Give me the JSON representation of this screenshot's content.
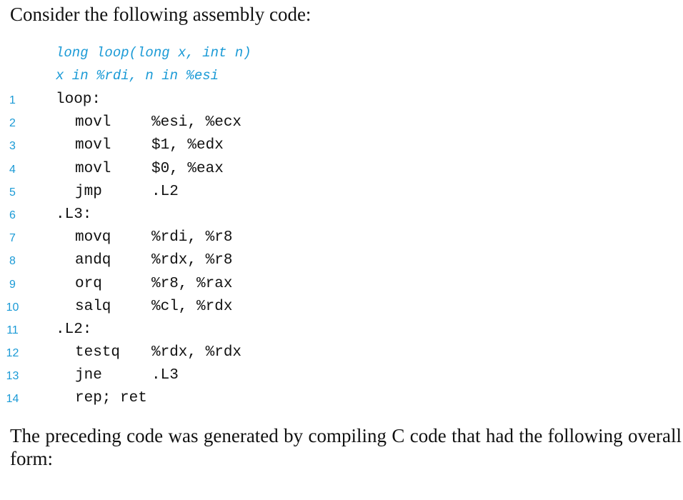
{
  "intro_text": "Consider the following assembly code:",
  "signature": {
    "line1": "long loop(long x, int n)",
    "line2": "x in %rdi, n in %esi"
  },
  "colors": {
    "accent": "#1a9ad6",
    "text": "#111111"
  },
  "code_lines": [
    {
      "num": "1",
      "label": "loop:",
      "op": "",
      "args": ""
    },
    {
      "num": "2",
      "label": "",
      "op": "movl",
      "args": "%esi, %ecx"
    },
    {
      "num": "3",
      "label": "",
      "op": "movl",
      "args": "$1, %edx"
    },
    {
      "num": "4",
      "label": "",
      "op": "movl",
      "args": "$0, %eax"
    },
    {
      "num": "5",
      "label": "",
      "op": "jmp",
      "args": ".L2"
    },
    {
      "num": "6",
      "label": ".L3:",
      "op": "",
      "args": ""
    },
    {
      "num": "7",
      "label": "",
      "op": "movq",
      "args": "%rdi, %r8"
    },
    {
      "num": "8",
      "label": "",
      "op": "andq",
      "args": "%rdx, %r8"
    },
    {
      "num": "9",
      "label": "",
      "op": "orq",
      "args": "%r8, %rax"
    },
    {
      "num": "10",
      "label": "",
      "op": "salq",
      "args": "%cl, %rdx"
    },
    {
      "num": "11",
      "label": ".L2:",
      "op": "",
      "args": ""
    },
    {
      "num": "12",
      "label": "",
      "op": "testq",
      "args": "%rdx, %rdx"
    },
    {
      "num": "13",
      "label": "",
      "op": "jne",
      "args": ".L3"
    },
    {
      "num": "14",
      "label": "",
      "op": "rep; ret",
      "args": ""
    }
  ],
  "outro_text": "The preceding code was generated by compiling C code that had the following overall form:"
}
